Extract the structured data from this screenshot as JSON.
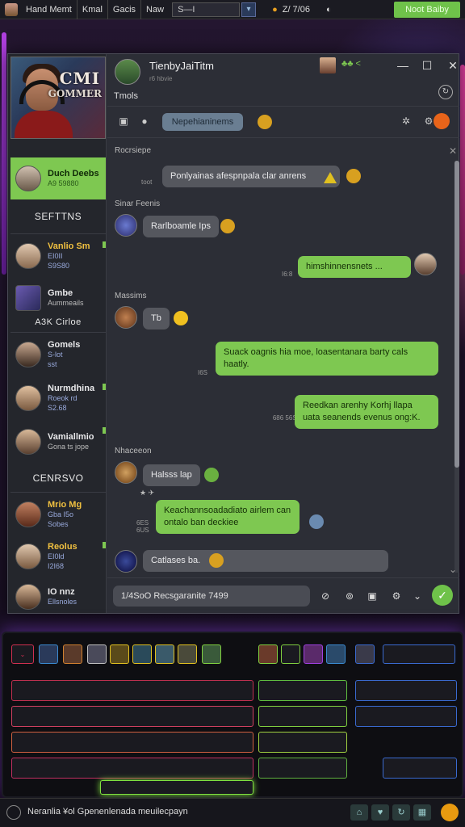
{
  "taskbar": {
    "items": [
      "Hand Memt",
      "Kmal",
      "Gacis",
      "Naw"
    ],
    "search_value": "S—I",
    "stat": "Z/ 7/06",
    "green_button": "Noot Baiby"
  },
  "sidebar": {
    "game_title": "CMI",
    "game_subtitle": "GOMMER",
    "active_item": {
      "name": "Duch Deebs",
      "sub": "A9 59880"
    },
    "section1": "SEFTTNS",
    "items": [
      {
        "name": "Vanlio Sm",
        "line2": "EI0II",
        "line3": "S9S80"
      },
      {
        "name": "Gmbe",
        "line2": "Aummeails",
        "line3": ""
      },
      {
        "name": "Gomels",
        "line2": "S-lot",
        "line3": "sst"
      },
      {
        "name": "Nurmdhina",
        "line2": "Roeok rd",
        "line3": "S2.68"
      },
      {
        "name": "Vamiallmio",
        "line2": "Gona ts jope",
        "line3": ""
      },
      {
        "name": "Mrio Mg",
        "line2": "Gba I5o",
        "line3": "Sobes"
      },
      {
        "name": "Reolus",
        "line2": "EI0ld",
        "line3": "I2I68"
      },
      {
        "name": "IO nnz",
        "line2": "Ellsnoles",
        "line3": ""
      }
    ],
    "label_mid": "A3K Cirloe",
    "section2": "CENRSVO"
  },
  "chat": {
    "title": "TienbyJaiTitm",
    "subtitle": "r6 hbvie",
    "label": "Tmols",
    "window_glyphs": {
      "min": "—",
      "max": "☐",
      "close": "✕"
    },
    "header_status": "♣♣ <",
    "toolbar_pill": "Nepehianinems",
    "sections": [
      "Rocrsiepe",
      "Sinar Feenis",
      "Massims",
      "Nhaceeon"
    ],
    "messages": [
      {
        "text": "Ponlyainas afespnpala clar anrens",
        "time": "toot"
      },
      {
        "text": "Rarlboamle Ips",
        "time": ""
      },
      {
        "text": "himshinnensnets ...",
        "time": "I6:8"
      },
      {
        "text": "Tb",
        "time": ""
      },
      {
        "text": "Suack oagnis hia moe, loasentanara barty cals haatly.",
        "time": "I6S"
      },
      {
        "text": "Reedkan arenhy Korhj llapa uata seanends evenus ong:K.",
        "time": "686 56SS"
      },
      {
        "text": "Halsss lap",
        "time": ""
      },
      {
        "text": "Keachannsoadadiato airlem can ontalo ban deckiee",
        "time": "6ES 6US"
      },
      {
        "text": "Catlases ba.",
        "time": ""
      }
    ],
    "composer_value": "1/4SoO Recsgaranite 7499"
  },
  "bottom": {
    "text": "Neranlia ¥ol Gpenenlenada meuilecpayn"
  },
  "colors": {
    "accent_green": "#7ec851",
    "bubble_gray": "#55575e",
    "panel": "#2c2e36",
    "orange": "#e8641a"
  }
}
